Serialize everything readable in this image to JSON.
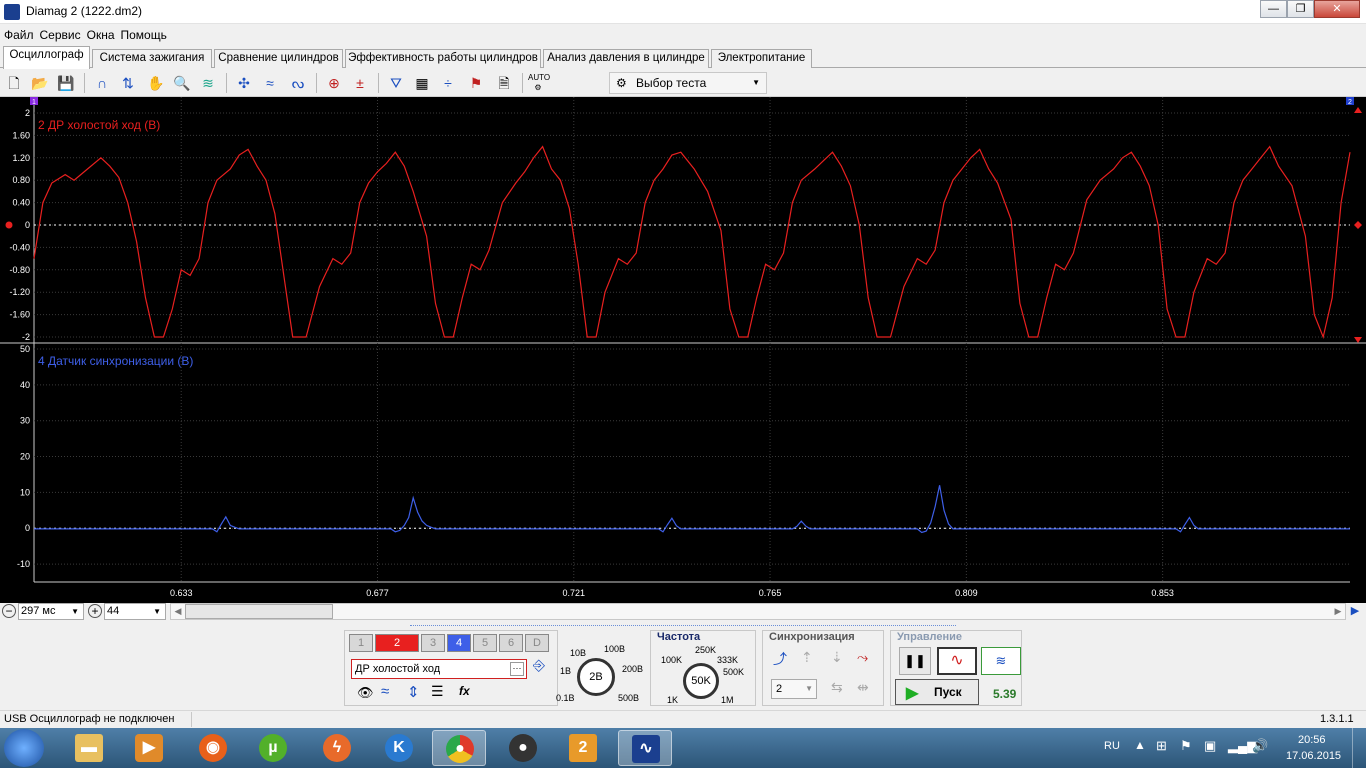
{
  "window": {
    "title": "Diamag 2 (1222.dm2)",
    "minimize": "—",
    "maximize": "❐",
    "close": "✕"
  },
  "menu": [
    "Файл",
    "Сервис",
    "Окна",
    "Помощь"
  ],
  "tabs": [
    "Осциллограф",
    "Система зажигания",
    "Сравнение цилиндров",
    "Эффективность работы цилиндров",
    "Анализ давления в цилиндре",
    "Электропитание"
  ],
  "toolbar": {
    "test_select": "Выбор теста",
    "auto_label": "AUTO"
  },
  "scope": {
    "channel_markers": [
      "1",
      "2"
    ],
    "x_ticks": [
      "0.633",
      "0.677",
      "0.721",
      "0.765",
      "0.809",
      "0.853"
    ],
    "colors": {
      "ch2": "#e8201f",
      "ch4": "#3e5fe8",
      "grid": "#3a3a3a"
    }
  },
  "chart_data": [
    {
      "type": "line",
      "title": "2 ДР холостой ход (В)",
      "yticks": [
        "2",
        "1.60",
        "1.20",
        "0.80",
        "0.40",
        "0",
        "-0.40",
        "-0.80",
        "-1.20",
        "-1.60",
        "-2"
      ],
      "ylim": [
        -2,
        2
      ],
      "xlim": [
        0.6,
        0.895
      ],
      "series": [
        {
          "x": [
            0.6,
            0.602,
            0.604,
            0.607,
            0.609,
            0.612,
            0.615,
            0.617,
            0.619,
            0.621,
            0.623,
            0.625,
            0.627,
            0.629,
            0.631,
            0.633,
            0.635,
            0.637,
            0.639,
            0.641,
            0.644,
            0.646,
            0.648,
            0.65,
            0.652,
            0.654,
            0.656,
            0.658,
            0.661,
            0.664,
            0.667,
            0.669,
            0.671,
            0.673,
            0.675,
            0.677,
            0.679,
            0.681,
            0.683,
            0.685,
            0.688,
            0.69,
            0.692,
            0.694,
            0.696,
            0.698,
            0.7,
            0.702,
            0.705,
            0.708,
            0.71,
            0.712,
            0.714,
            0.716,
            0.718,
            0.72,
            0.722,
            0.724,
            0.726,
            0.728,
            0.731,
            0.733,
            0.735,
            0.737,
            0.739,
            0.741,
            0.743,
            0.745,
            0.748,
            0.751,
            0.754,
            0.756,
            0.758,
            0.76,
            0.762,
            0.764,
            0.766,
            0.768,
            0.77,
            0.772,
            0.775,
            0.777,
            0.779,
            0.781,
            0.783,
            0.785,
            0.787,
            0.789,
            0.792,
            0.795,
            0.798,
            0.8,
            0.802,
            0.804,
            0.806,
            0.808,
            0.81,
            0.812,
            0.814,
            0.816,
            0.819,
            0.821,
            0.823,
            0.825,
            0.827,
            0.829,
            0.831,
            0.833,
            0.836,
            0.839,
            0.842,
            0.844,
            0.846,
            0.848,
            0.85,
            0.852,
            0.854,
            0.856,
            0.858,
            0.86,
            0.863,
            0.865,
            0.867,
            0.869,
            0.871,
            0.873,
            0.875,
            0.877,
            0.879,
            0.882,
            0.885,
            0.887,
            0.889,
            0.891,
            0.893,
            0.895
          ],
          "y": [
            -0.6,
            0.4,
            0.75,
            0.9,
            0.8,
            1.0,
            1.2,
            1.05,
            0.85,
            0.4,
            -0.3,
            -1.3,
            -2,
            -2,
            -1.5,
            -0.8,
            -0.9,
            -0.6,
            0.4,
            0.8,
            1.0,
            1.25,
            1.35,
            1.05,
            0.8,
            0.2,
            -0.9,
            -2,
            -2,
            -1.1,
            -0.6,
            -0.7,
            -0.5,
            0.4,
            0.75,
            0.95,
            1.1,
            1.3,
            1.05,
            0.6,
            -0.2,
            -1.4,
            -2,
            -2,
            -1.3,
            -0.7,
            -0.8,
            -0.45,
            0.4,
            0.75,
            0.95,
            1.2,
            1.4,
            1.0,
            0.8,
            0.3,
            -0.7,
            -2,
            -2,
            -1.2,
            -0.6,
            -0.7,
            -0.5,
            0.4,
            0.8,
            1.0,
            1.25,
            1.3,
            1.0,
            0.6,
            -0.1,
            -1.5,
            -2,
            -2,
            -1.3,
            -0.7,
            -0.8,
            -0.5,
            0.4,
            0.8,
            1.0,
            1.15,
            1.3,
            1.05,
            0.7,
            0.0,
            -1.3,
            -2,
            -2,
            -1.1,
            -0.6,
            -0.7,
            -0.45,
            0.4,
            0.8,
            1.0,
            1.2,
            1.35,
            1.0,
            0.75,
            0.1,
            -1.4,
            -2,
            -2,
            -1.3,
            -0.7,
            -0.8,
            -0.5,
            0.45,
            0.8,
            1.0,
            1.2,
            1.3,
            1.05,
            0.7,
            0.0,
            -1.5,
            -2,
            -2,
            -1.2,
            -0.6,
            -0.7,
            -0.5,
            0.4,
            0.8,
            1.0,
            1.2,
            1.4,
            1.05,
            0.7,
            -0.2,
            -1.6,
            -2,
            -1.3,
            0.4,
            1.3
          ]
        }
      ]
    },
    {
      "type": "line",
      "title": "4 Датчик синхронизации (В)",
      "yticks": [
        "50",
        "40",
        "30",
        "20",
        "10",
        "0",
        "-10"
      ],
      "ylim": [
        -15,
        50
      ],
      "xlim": [
        0.6,
        0.895
      ],
      "series": [
        {
          "x": [
            0.6,
            0.64,
            0.641,
            0.642,
            0.643,
            0.644,
            0.645,
            0.646,
            0.68,
            0.681,
            0.682,
            0.683,
            0.684,
            0.685,
            0.686,
            0.687,
            0.688,
            0.689,
            0.69,
            0.74,
            0.741,
            0.742,
            0.743,
            0.744,
            0.745,
            0.77,
            0.771,
            0.772,
            0.773,
            0.774,
            0.798,
            0.799,
            0.8,
            0.801,
            0.802,
            0.803,
            0.804,
            0.805,
            0.806,
            0.856,
            0.857,
            0.858,
            0.859,
            0.86,
            0.861,
            0.895
          ],
          "y": [
            -0.2,
            -0.2,
            -1,
            1.2,
            3.2,
            0.8,
            0.3,
            -0.2,
            -0.2,
            -1,
            -0.6,
            0.8,
            3,
            8.5,
            4.5,
            2,
            0.8,
            0.3,
            -0.2,
            -0.2,
            -1,
            1,
            2.8,
            0.7,
            -0.2,
            -0.2,
            0.5,
            2,
            0.6,
            -0.2,
            -0.2,
            -1.2,
            -0.8,
            1.5,
            6,
            12,
            5,
            1.2,
            -0.2,
            -0.2,
            -1,
            1,
            3,
            0.8,
            -0.2,
            -0.2
          ]
        }
      ]
    }
  ],
  "strip": {
    "timebase": "297 мс",
    "zoom": "44"
  },
  "panel": {
    "channels": [
      "1",
      "2",
      "3",
      "4",
      "5",
      "6",
      "D"
    ],
    "channel_name": "ДР холостой ход",
    "volt_labels": [
      "10В",
      "100В",
      "1В",
      "200В",
      "0.1В",
      "500В"
    ],
    "volt_value": "2В",
    "freq_title": "Частота",
    "freq_labels": [
      "250K",
      "100K",
      "333K",
      "500K",
      "1K",
      "1M"
    ],
    "freq_value": "50K",
    "sync_title": "Синхронизация",
    "sync_channel": "2",
    "control_title": "Управление",
    "start_button": "Пуск",
    "value": "5.39"
  },
  "status": {
    "left": "USB Осциллограф не подключен",
    "right": "1.3.1.1"
  },
  "taskbar": {
    "lang": "RU",
    "time": "20:56",
    "date": "17.06.2015"
  }
}
